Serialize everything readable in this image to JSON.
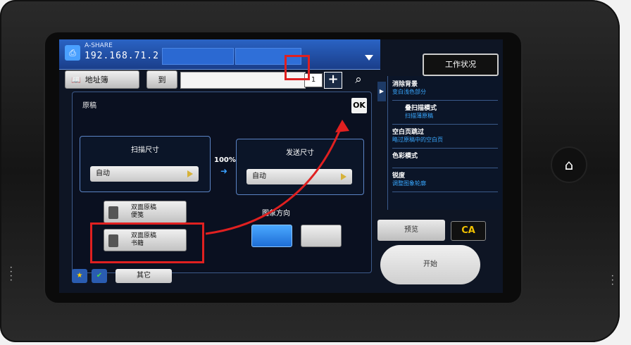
{
  "device": {
    "name": "A-SHARE",
    "ip": "192.168.71.2"
  },
  "header": {
    "status_button": "工作状况"
  },
  "toolbar": {
    "address_book": "地址簿",
    "to_label": "到",
    "count": "1",
    "plus": "+",
    "search_icon": "search-icon"
  },
  "panel": {
    "title": "原稿",
    "ok_label": "OK",
    "scan_size": {
      "label": "扫描尺寸",
      "value": "自动"
    },
    "send_size": {
      "label": "发送尺寸",
      "value": "自动"
    },
    "ratio": "100%",
    "duplex_booklet": {
      "line1": "双面原稿",
      "line2": "便笺"
    },
    "duplex_book": {
      "line1": "双面原稿",
      "line2": "书籍"
    },
    "orientation_label": "图象方向"
  },
  "footer": {
    "others": "其它"
  },
  "right_panel": {
    "items": [
      {
        "title": "消除背景",
        "sub": "变白浅色部分"
      },
      {
        "title": "叠扫描模式",
        "sub": "扫描薄原稿"
      },
      {
        "title": "空白页跳过",
        "sub": "略过原稿中的空白页"
      },
      {
        "title": "色彩模式",
        "sub": ""
      },
      {
        "title": "锐度",
        "sub": "调整图象轮廓"
      }
    ]
  },
  "actions": {
    "preview": "预览",
    "ca": "CA",
    "start": "开始"
  },
  "colors": {
    "highlight": "#e02020",
    "accent": "#39a8ff"
  }
}
